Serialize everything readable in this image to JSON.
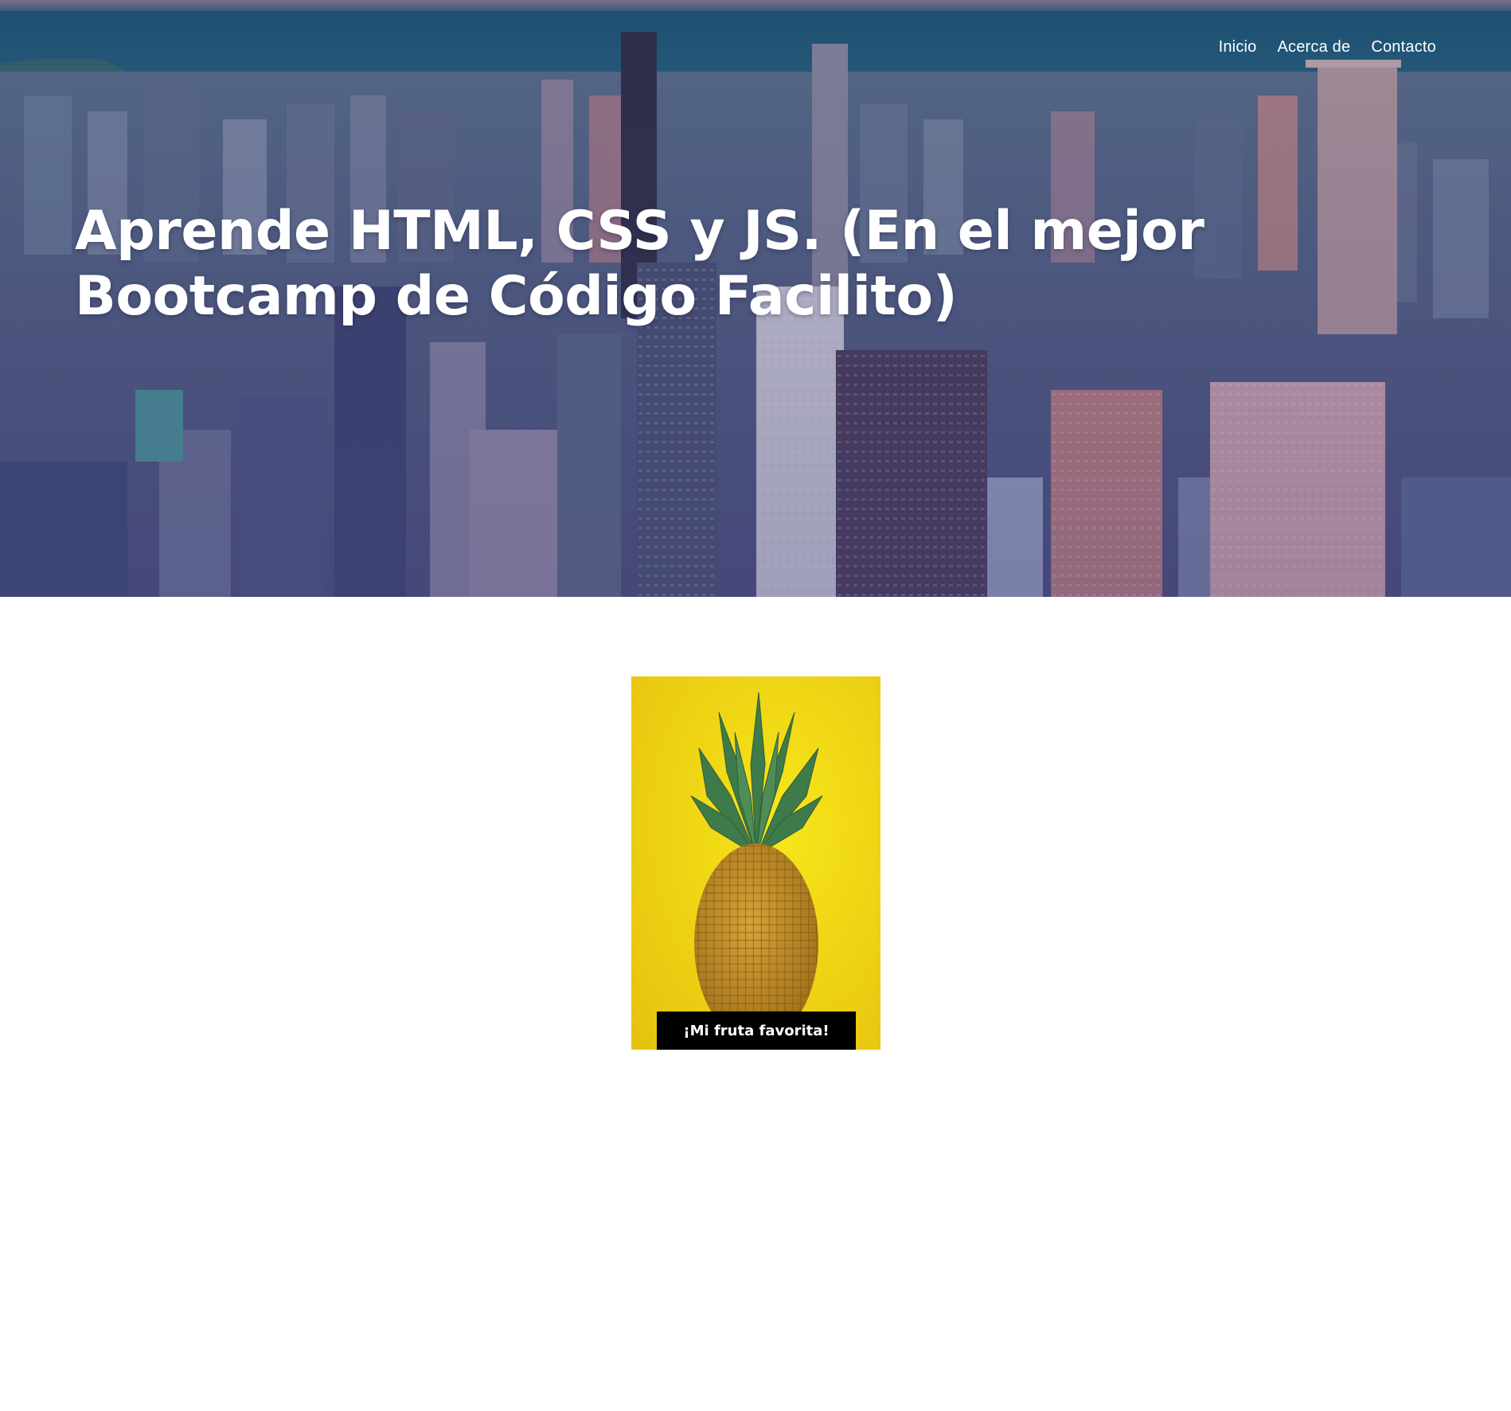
{
  "nav": {
    "items": [
      {
        "label": "Inicio"
      },
      {
        "label": "Acerca de"
      },
      {
        "label": "Contacto"
      }
    ]
  },
  "hero": {
    "title": "Aprende HTML, CSS y JS. (En el mejor Bootcamp de Código Facilito)",
    "background_image": "city-skyline-aerial"
  },
  "figure": {
    "image": "pineapple-on-yellow",
    "caption": "¡Mi fruta favorita!"
  },
  "colors": {
    "overlay": "#3a3f7a",
    "caption_bg": "#000000",
    "figure_bg": "#f2d51a"
  }
}
